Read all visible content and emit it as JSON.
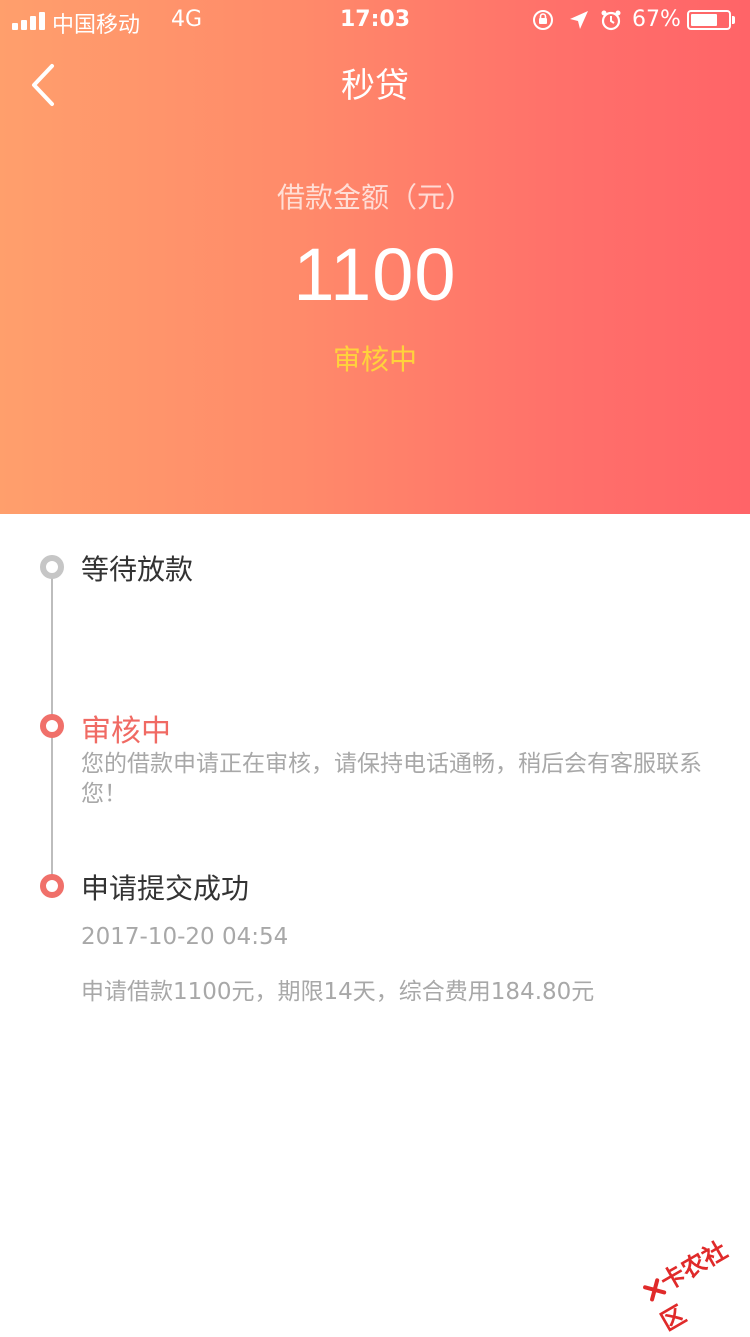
{
  "status_bar": {
    "carrier": "中国移动",
    "network": "4G",
    "time": "17:03",
    "battery_percent": "67%",
    "icons": [
      "signal-icon",
      "orientation-lock-icon",
      "location-icon",
      "alarm-icon",
      "battery-icon"
    ]
  },
  "nav": {
    "title": "秒贷",
    "back_icon": "chevron-left-icon"
  },
  "loan": {
    "amount_label": "借款金额（元）",
    "amount": "1100",
    "status": "审核中"
  },
  "timeline": {
    "steps": [
      {
        "title": "等待放款",
        "state": "pending"
      },
      {
        "title": "审核中",
        "state": "current",
        "description": "您的借款申请正在审核，请保持电话通畅，稍后会有客服联系您！"
      },
      {
        "title": "申请提交成功",
        "state": "done",
        "timestamp": "2017-10-20 04:54",
        "detail": "申请借款1100元，期限14天，综合费用184.80元"
      }
    ]
  },
  "watermark": "卡农社区",
  "colors": {
    "header_gradient_start": "#ff9f6c",
    "header_gradient_end": "#ff6468",
    "accent_red": "#f06a63",
    "status_yellow": "#ffd23c",
    "pending_grey": "#c6c6c6",
    "muted_text": "#a8a8a8"
  }
}
